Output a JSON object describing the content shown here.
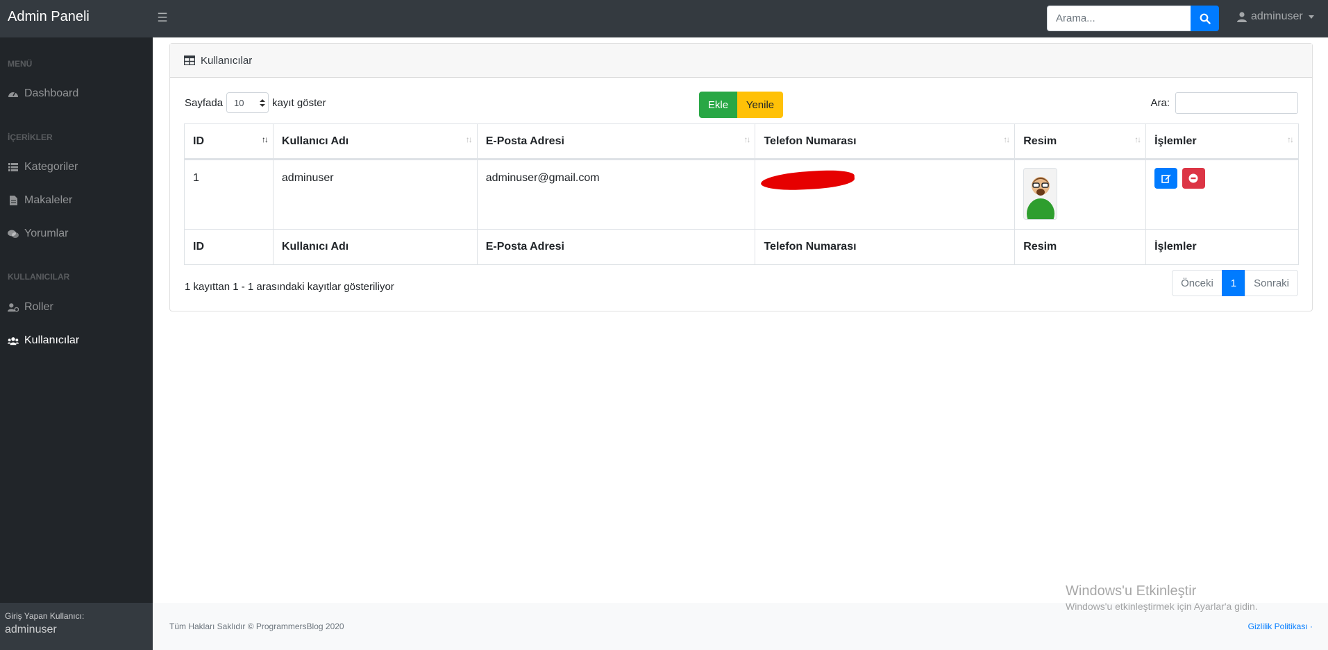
{
  "navbar": {
    "brand": "Admin Paneli",
    "search_placeholder": "Arama...",
    "user": "adminuser"
  },
  "sidebar": {
    "sections": [
      {
        "heading": "MENÜ",
        "items": [
          {
            "label": "Dashboard",
            "icon": "tachometer-icon"
          }
        ]
      },
      {
        "heading": "İÇERİKLER",
        "items": [
          {
            "label": "Kategoriler",
            "icon": "list-icon"
          },
          {
            "label": "Makaleler",
            "icon": "file-icon"
          },
          {
            "label": "Yorumlar",
            "icon": "comments-icon"
          }
        ]
      },
      {
        "heading": "KULLANICILAR",
        "items": [
          {
            "label": "Roller",
            "icon": "user-cog-icon"
          },
          {
            "label": "Kullanıcılar",
            "icon": "users-icon",
            "active": true
          }
        ]
      }
    ],
    "footer_label": "Giriş Yapan Kullanıcı:",
    "footer_user": "adminuser"
  },
  "card": {
    "title": "Kullanıcılar",
    "length_prefix": "Sayfada",
    "length_value": "10",
    "length_suffix": "kayıt göster",
    "add_label": "Ekle",
    "refresh_label": "Yenile",
    "filter_label": "Ara:"
  },
  "table": {
    "columns": [
      "ID",
      "Kullanıcı Adı",
      "E-Posta Adresi",
      "Telefon Numarası",
      "Resim",
      "İşlemler"
    ],
    "rows": [
      {
        "id": "1",
        "username": "adminuser",
        "email": "adminuser@gmail.com",
        "phone": "",
        "image": "user-avatar",
        "actions": [
          "edit-icon",
          "delete-icon"
        ]
      }
    ]
  },
  "pagination": {
    "info": "1 kayıttan 1 - 1 arasındaki kayıtlar gösteriliyor",
    "prev": "Önceki",
    "current": "1",
    "next": "Sonraki"
  },
  "footer": {
    "copyright": "Tüm Hakları Saklıdır © ProgrammersBlog 2020",
    "links": "Gizlilik Politikası ·"
  },
  "watermark": {
    "title": "Windows'u Etkinleştir",
    "subtitle": "Windows'u etkinleştirmek için Ayarlar'a gidin."
  },
  "colors": {
    "primary": "#007bff",
    "success": "#28a745",
    "warning": "#ffc107",
    "danger": "#dc3545",
    "navbar": "#343a40",
    "sidebar": "#212529"
  }
}
